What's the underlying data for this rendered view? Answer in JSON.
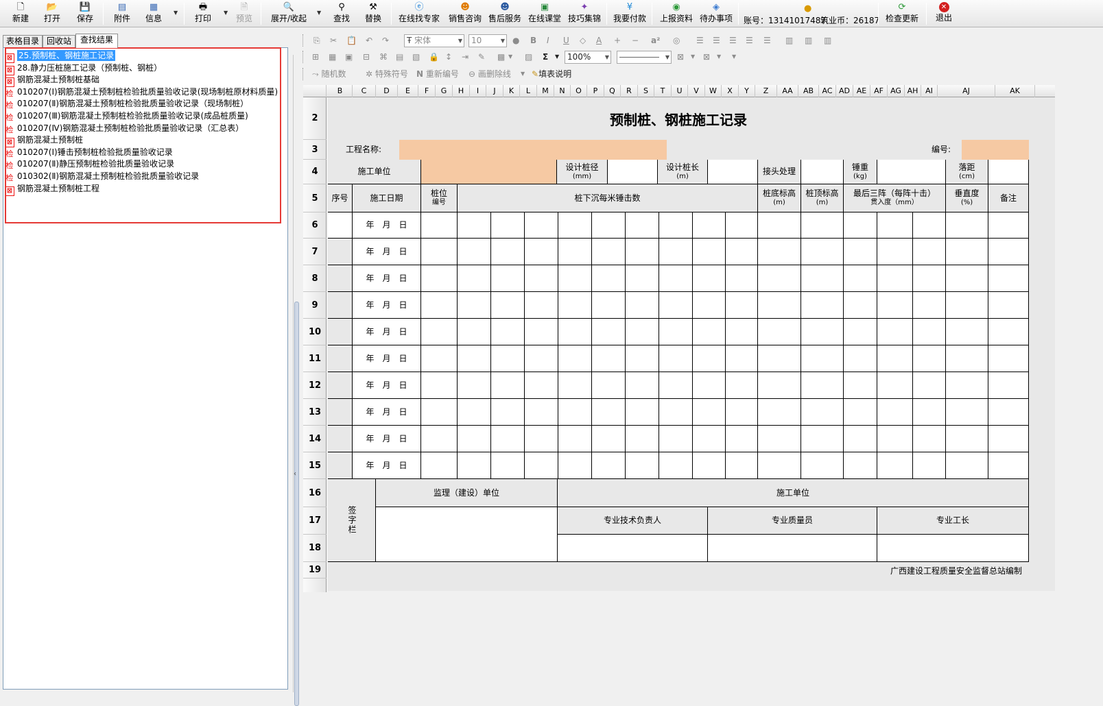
{
  "toolbar": {
    "new": "新建",
    "open": "打开",
    "save": "保存",
    "attach": "附件",
    "info": "信息",
    "print": "打印",
    "preview": "预览",
    "expand": "展开/收起",
    "find": "查找",
    "replace": "替换",
    "expert": "在线找专家",
    "sales": "销售咨询",
    "aftersales": "售后服务",
    "classroom": "在线课堂",
    "tips": "技巧集锦",
    "pay": "我要付款",
    "upload": "上报资料",
    "todo": "待办事项",
    "account": "账号：13141017487",
    "coins": "筑业币：26187",
    "update": "检查更新",
    "exit": "退出"
  },
  "left": {
    "tabs": [
      "表格目录",
      "回收站",
      "查找结果"
    ],
    "items": [
      {
        "icon": "x",
        "label": "25.预制桩、钢桩施工记录"
      },
      {
        "icon": "x",
        "label": "28.静力压桩施工记录（预制桩、钢桩）"
      },
      {
        "icon": "x",
        "label": "钢筋混凝土预制桩基础"
      },
      {
        "icon": "jian",
        "label": "010207(Ⅰ)钢筋混凝土预制桩检验批质量验收记录(现场制桩原材料质量)"
      },
      {
        "icon": "jian",
        "label": "010207(Ⅱ)钢筋混凝土预制桩检验批质量验收记录（现场制桩）"
      },
      {
        "icon": "jian",
        "label": "010207(Ⅲ)钢筋混凝土预制桩检验批质量验收记录(成品桩质量)"
      },
      {
        "icon": "jian",
        "label": "010207(Ⅳ)钢筋混凝土预制桩检验批质量验收记录（汇总表）"
      },
      {
        "icon": "x",
        "label": "钢筋混凝土预制桩"
      },
      {
        "icon": "jian",
        "label": "010207(Ⅰ)锤击预制桩检验批质量验收记录"
      },
      {
        "icon": "jian",
        "label": "010207(Ⅱ)静压预制桩检验批质量验收记录"
      },
      {
        "icon": "jian",
        "label": "010302(Ⅱ)钢筋混凝土预制桩检验批质量验收记录"
      },
      {
        "icon": "x",
        "label": "钢筋混凝土预制桩工程"
      }
    ],
    "icon_x": "⊠",
    "icon_jian": "检"
  },
  "format": {
    "font": "宋体",
    "size": "10",
    "zoom": "100%",
    "random": "随机数",
    "special": "特殊符号",
    "renumber": "重新编号",
    "delline": "画删除线",
    "guide": "填表说明",
    "sigma": "Σ",
    "superscript": "a²"
  },
  "sheet": {
    "columns": [
      "B",
      "C",
      "D",
      "E",
      "F",
      "G",
      "H",
      "I",
      "J",
      "K",
      "L",
      "M",
      "N",
      "O",
      "P",
      "Q",
      "R",
      "S",
      "T",
      "U",
      "V",
      "W",
      "X",
      "Y",
      "Z",
      "AA",
      "AB",
      "AC",
      "AD",
      "AE",
      "AF",
      "AG",
      "AH",
      "AI",
      "AJ",
      "AK"
    ],
    "rows": [
      "2",
      "3",
      "4",
      "5",
      "6",
      "7",
      "8",
      "9",
      "10",
      "11",
      "12",
      "13",
      "14",
      "15",
      "16",
      "17",
      "18",
      "19"
    ],
    "title": "预制桩、钢桩施工记录",
    "project_name": "工程名称:",
    "number": "编号:",
    "construct_unit": "施工单位",
    "design_dia": "设计桩径",
    "design_dia_unit": "(mm)",
    "design_len": "设计桩长",
    "design_len_unit": "(m)",
    "joint": "接头处理",
    "hammer": "锤重",
    "hammer_unit": "(kg)",
    "drop": "落距",
    "drop_unit": "(cm)",
    "seq": "序号",
    "date": "施工日期",
    "pile_no_1": "桩位",
    "pile_no_2": "编号",
    "blows": "桩下沉每米锤击数",
    "bottom_elev": "桩底标高",
    "bottom_elev_unit": "(m)",
    "top_elev": "桩顶标高",
    "top_elev_unit": "(m)",
    "last3": "最后三阵（每阵十击）",
    "last3_2": "贯入度（mm）",
    "vertical": "垂直度",
    "vertical_unit": "(%)",
    "remark": "备注",
    "date_template": "年　月　日",
    "signature": "签字栏",
    "supervisor": "监理（建设）单位",
    "builder": "施工单位",
    "tech_lead": "专业技术负责人",
    "quality": "专业质量员",
    "foreman": "专业工长",
    "footer": "广西建设工程质量安全监督总站编制"
  }
}
